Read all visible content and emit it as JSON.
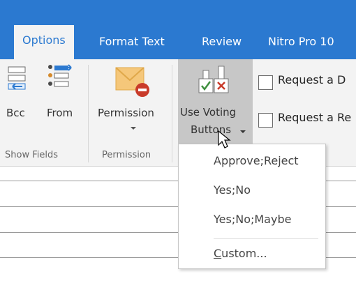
{
  "tabs": [
    {
      "label": "Options",
      "active": true
    },
    {
      "label": "Format Text",
      "active": false
    },
    {
      "label": "Review",
      "active": false
    },
    {
      "label": "Nitro Pro 10",
      "active": false
    }
  ],
  "ribbon": {
    "bcc_label": "Bcc",
    "from_label": "From",
    "show_fields_group": "Show Fields",
    "permission_label": "Permission",
    "permission_group": "Permission",
    "voting_label_line1": "Use Voting",
    "voting_label_line2": "Buttons",
    "request_delivery": "Request a D",
    "request_read": "Request a Re"
  },
  "voting_menu": {
    "items": [
      "Approve;Reject",
      "Yes;No",
      "Yes;No;Maybe"
    ],
    "custom_prefix": "C",
    "custom_rest": "ustom..."
  },
  "colors": {
    "accent": "#2b79d0",
    "ribbon_bg": "#f3f3f3",
    "pressed_bg": "#c7c7c7"
  }
}
